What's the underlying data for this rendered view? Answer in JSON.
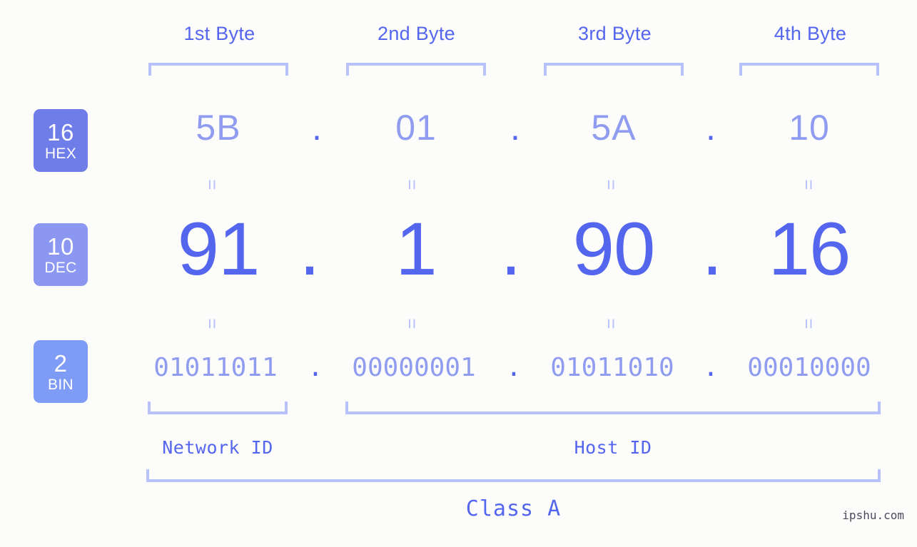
{
  "meta": {
    "watermark": "ipshu.com",
    "background_color": "#fcfdfa",
    "accent_dark": "#5566ee",
    "accent_light": "#8f9cf0",
    "bracket_color": "#b8c2fa"
  },
  "byte_headers": [
    {
      "label": "1st Byte"
    },
    {
      "label": "2nd Byte"
    },
    {
      "label": "3rd Byte"
    },
    {
      "label": "4th Byte"
    }
  ],
  "rows": [
    {
      "badge_number": "16",
      "badge_tag": "HEX",
      "badge_color": "#6f7de9",
      "values": [
        "5B",
        "01",
        "5A",
        "10"
      ],
      "separator": "."
    },
    {
      "badge_number": "10",
      "badge_tag": "DEC",
      "badge_color": "#8b97f0",
      "values": [
        "91",
        "1",
        "90",
        "16"
      ],
      "separator": "."
    },
    {
      "badge_number": "2",
      "badge_tag": "BIN",
      "badge_color": "#7e9bf5",
      "values": [
        "01011011",
        "00000001",
        "01011010",
        "00010000"
      ],
      "separator": "."
    }
  ],
  "equals_marks": {
    "glyph": "=",
    "count_per_gap": 4
  },
  "sections": [
    {
      "label": "Network ID"
    },
    {
      "label": "Host ID"
    }
  ],
  "class": {
    "label": "Class A"
  }
}
